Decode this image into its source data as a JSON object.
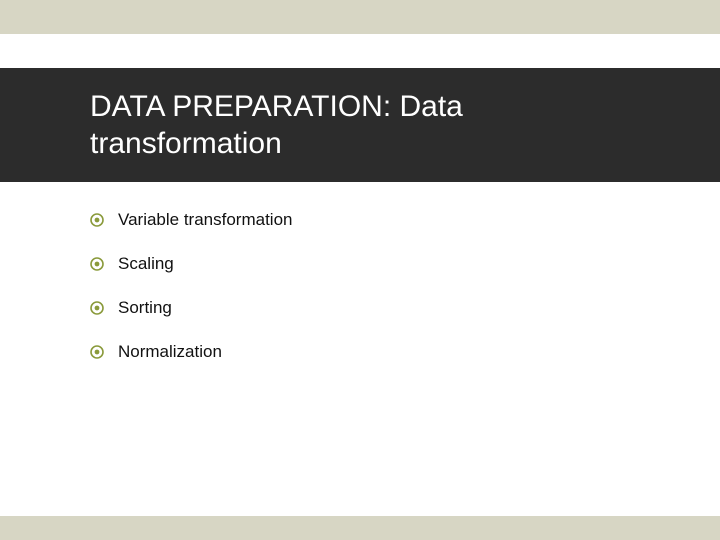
{
  "colors": {
    "accent_band": "#d7d6c4",
    "title_bg": "#2c2c2c",
    "title_fg": "#ffffff",
    "bullet_color": "#8a9a3b"
  },
  "title": "DATA PREPARATION:  Data transformation",
  "bullets": [
    {
      "label": "Variable transformation"
    },
    {
      "label": "Scaling"
    },
    {
      "label": "Sorting"
    },
    {
      "label": "Normalization"
    }
  ]
}
